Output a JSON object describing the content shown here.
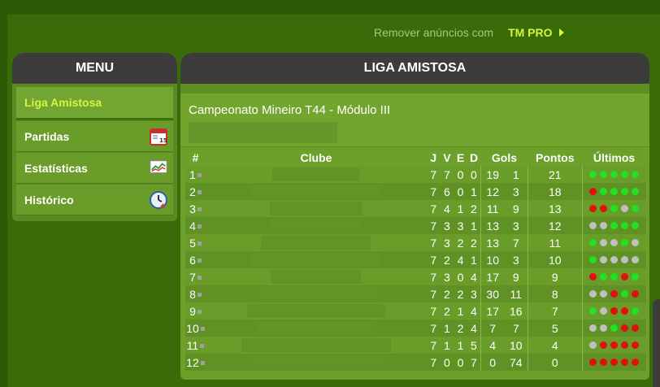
{
  "header": {
    "remove_ads": "Remover anúncios com",
    "tm_pro": "TM PRO"
  },
  "menu": {
    "title": "MENU",
    "items": [
      {
        "label": "Liga Amistosa",
        "active": true,
        "icon": ""
      },
      {
        "label": "Partidas",
        "active": false,
        "icon": "calendar-icon"
      },
      {
        "label": "Estatísticas",
        "active": false,
        "icon": "chart-icon"
      },
      {
        "label": "Histórico",
        "active": false,
        "icon": "clock-icon"
      }
    ]
  },
  "league": {
    "title": "LIGA AMISTOSA",
    "competition": "Campeonato Mineiro T44 - Módulo III",
    "columns": {
      "pos": "#",
      "club": "Clube",
      "j": "J",
      "v": "V",
      "e": "E",
      "d": "D",
      "gols": "Gols",
      "pontos": "Pontos",
      "ultimos": "Últimos"
    },
    "rows": [
      {
        "pos": "1",
        "j": "7",
        "v": "7",
        "e": "0",
        "d": "0",
        "gf": "19",
        "ga": "1",
        "pts": "21",
        "last": [
          "W",
          "W",
          "W",
          "W",
          "W"
        ]
      },
      {
        "pos": "2",
        "j": "7",
        "v": "6",
        "e": "0",
        "d": "1",
        "gf": "12",
        "ga": "3",
        "pts": "18",
        "last": [
          "L",
          "W",
          "W",
          "W",
          "W"
        ]
      },
      {
        "pos": "3",
        "j": "7",
        "v": "4",
        "e": "1",
        "d": "2",
        "gf": "11",
        "ga": "9",
        "pts": "13",
        "last": [
          "L",
          "L",
          "W",
          "D",
          "W"
        ]
      },
      {
        "pos": "4",
        "j": "7",
        "v": "3",
        "e": "3",
        "d": "1",
        "gf": "13",
        "ga": "3",
        "pts": "12",
        "last": [
          "D",
          "D",
          "W",
          "W",
          "W"
        ]
      },
      {
        "pos": "5",
        "j": "7",
        "v": "3",
        "e": "2",
        "d": "2",
        "gf": "13",
        "ga": "7",
        "pts": "11",
        "last": [
          "W",
          "D",
          "D",
          "W",
          "D"
        ]
      },
      {
        "pos": "6",
        "j": "7",
        "v": "2",
        "e": "4",
        "d": "1",
        "gf": "10",
        "ga": "3",
        "pts": "10",
        "last": [
          "W",
          "D",
          "D",
          "D",
          "D"
        ]
      },
      {
        "pos": "7",
        "j": "7",
        "v": "3",
        "e": "0",
        "d": "4",
        "gf": "17",
        "ga": "9",
        "pts": "9",
        "last": [
          "L",
          "W",
          "W",
          "L",
          "W"
        ]
      },
      {
        "pos": "8",
        "j": "7",
        "v": "2",
        "e": "2",
        "d": "3",
        "gf": "30",
        "ga": "11",
        "pts": "8",
        "last": [
          "D",
          "D",
          "L",
          "W",
          "L"
        ]
      },
      {
        "pos": "9",
        "j": "7",
        "v": "2",
        "e": "1",
        "d": "4",
        "gf": "17",
        "ga": "16",
        "pts": "7",
        "last": [
          "W",
          "D",
          "L",
          "L",
          "W"
        ]
      },
      {
        "pos": "10",
        "j": "7",
        "v": "1",
        "e": "2",
        "d": "4",
        "gf": "7",
        "ga": "7",
        "pts": "5",
        "last": [
          "D",
          "D",
          "W",
          "L",
          "L"
        ]
      },
      {
        "pos": "11",
        "j": "7",
        "v": "1",
        "e": "1",
        "d": "5",
        "gf": "4",
        "ga": "10",
        "pts": "4",
        "last": [
          "D",
          "L",
          "L",
          "L",
          "L"
        ]
      },
      {
        "pos": "12",
        "j": "7",
        "v": "0",
        "e": "0",
        "d": "7",
        "gf": "0",
        "ga": "74",
        "pts": "0",
        "last": [
          "L",
          "L",
          "L",
          "L",
          "L"
        ]
      }
    ]
  },
  "colors": {
    "win": "#22e022",
    "loss": "#e01010",
    "draw": "#c0c0c0",
    "accent": "#d4f542"
  }
}
